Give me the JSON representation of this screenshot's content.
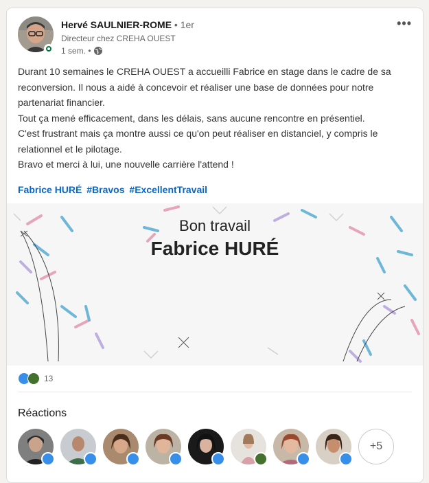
{
  "post": {
    "author_name": "Hervé SAULNIER-ROME",
    "connection_degree": "• 1er",
    "headline": "Directeur chez CREHA OUEST",
    "time": "1 sem. •",
    "more_icon": "ellipsis-icon",
    "visibility_icon": "globe-icon",
    "body_lines": [
      "Durant 10 semaines le CREHA OUEST a accueilli Fabrice en stage dans le cadre de sa",
      "reconversion. Il nous a aidé à concevoir et réaliser une base de données pour notre",
      "partenariat financier.",
      "Tout ça mené efficacement, dans les délais, sans aucune rencontre en présentiel.",
      "C'est frustrant mais ça montre aussi ce qu'on peut réaliser en distanciel, y compris le",
      "relationnel et le pilotage.",
      "Bravo et merci à lui, une nouvelle carrière l'attend !"
    ],
    "mention": "Fabrice HURÉ",
    "hashtags": [
      "#Bravos",
      "#ExcellentTravail"
    ],
    "image": {
      "line1": "Bon travail",
      "line2": "Fabrice HURÉ"
    }
  },
  "social": {
    "reaction_icons": [
      "like-icon",
      "celebrate-icon"
    ],
    "reaction_count": "13"
  },
  "reactions_section": {
    "title": "Réactions",
    "more_label": "+5",
    "people": [
      {
        "reaction": "like"
      },
      {
        "reaction": "like"
      },
      {
        "reaction": "like"
      },
      {
        "reaction": "like"
      },
      {
        "reaction": "like"
      },
      {
        "reaction": "celebrate"
      },
      {
        "reaction": "like"
      },
      {
        "reaction": "like"
      }
    ]
  },
  "colors": {
    "link": "#0a66c2",
    "like": "#378fe9",
    "celebrate": "#44712e",
    "presence": "#057642"
  }
}
